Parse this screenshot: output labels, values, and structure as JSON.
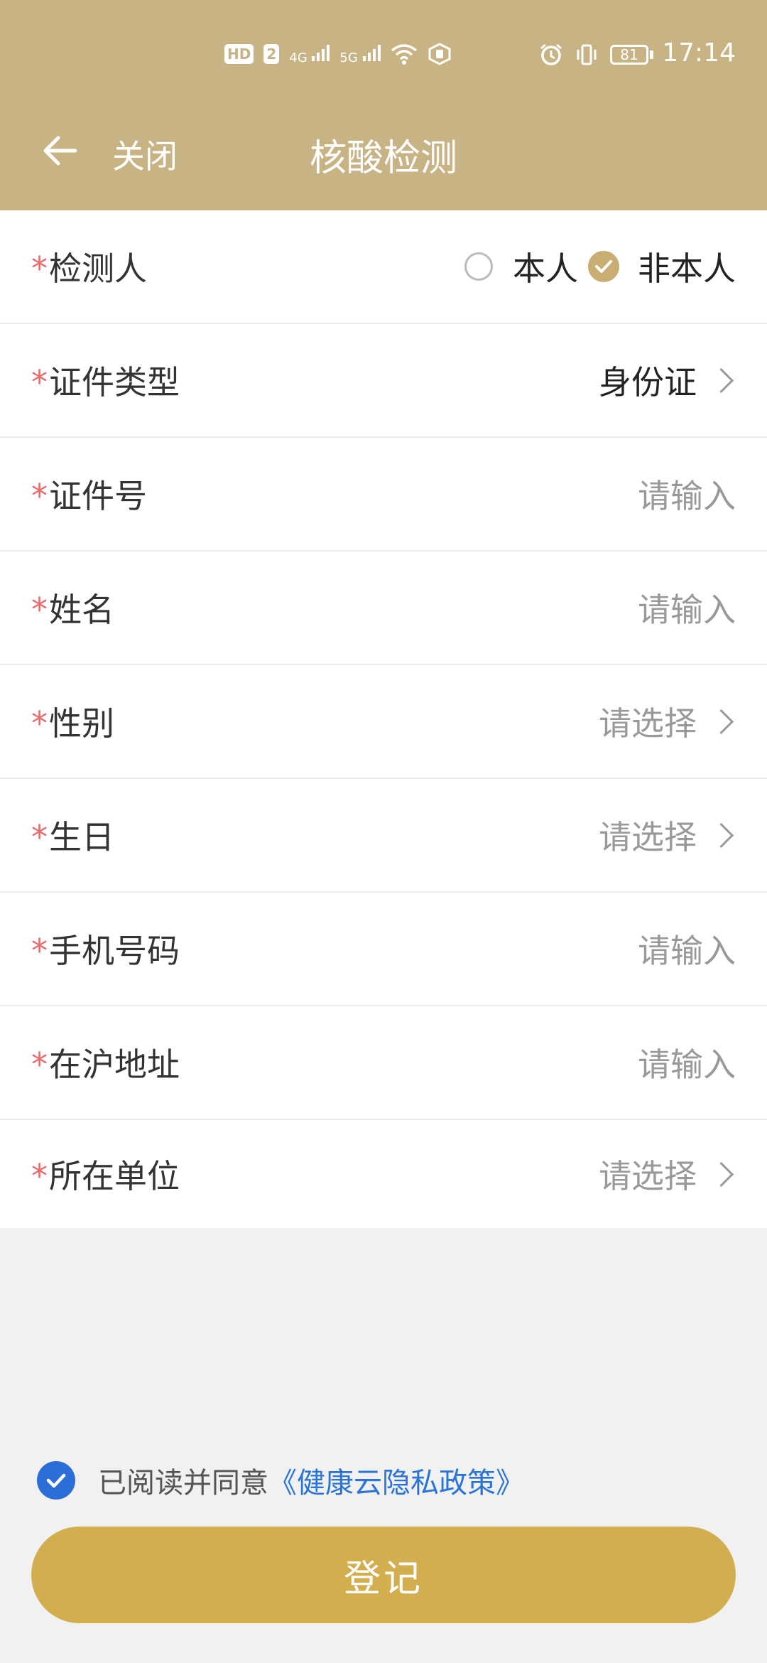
{
  "status_bar": {
    "left_badges": [
      "HD",
      "2",
      "4G",
      "5G"
    ],
    "battery": "81",
    "time": "17:14"
  },
  "header": {
    "close_label": "关闭",
    "title": "核酸检测"
  },
  "form": {
    "required_mark": "*",
    "tester": {
      "label": "检测人",
      "options": [
        "本人",
        "非本人"
      ],
      "selected": "非本人"
    },
    "id_type": {
      "label": "证件类型",
      "value": "身份证"
    },
    "id_number": {
      "label": "证件号",
      "placeholder": "请输入"
    },
    "name": {
      "label": "姓名",
      "placeholder": "请输入"
    },
    "gender": {
      "label": "性别",
      "placeholder": "请选择"
    },
    "birthday": {
      "label": "生日",
      "placeholder": "请选择"
    },
    "phone": {
      "label": "手机号码",
      "placeholder": "请输入"
    },
    "address": {
      "label": "在沪地址",
      "placeholder": "请输入"
    },
    "employer": {
      "label": "所在单位",
      "placeholder": "请选择"
    }
  },
  "agreement": {
    "checked": true,
    "text": "已阅读并同意",
    "link": "《健康云隐私政策》"
  },
  "submit_label": "登记",
  "colors": {
    "header_bg": "#c8b384",
    "accent_gold": "#c9ad72",
    "button_bg": "#d3ae4f",
    "required_red": "#e66b6b",
    "link_blue": "#2a74d6",
    "checkbox_blue": "#2b6ed8"
  }
}
